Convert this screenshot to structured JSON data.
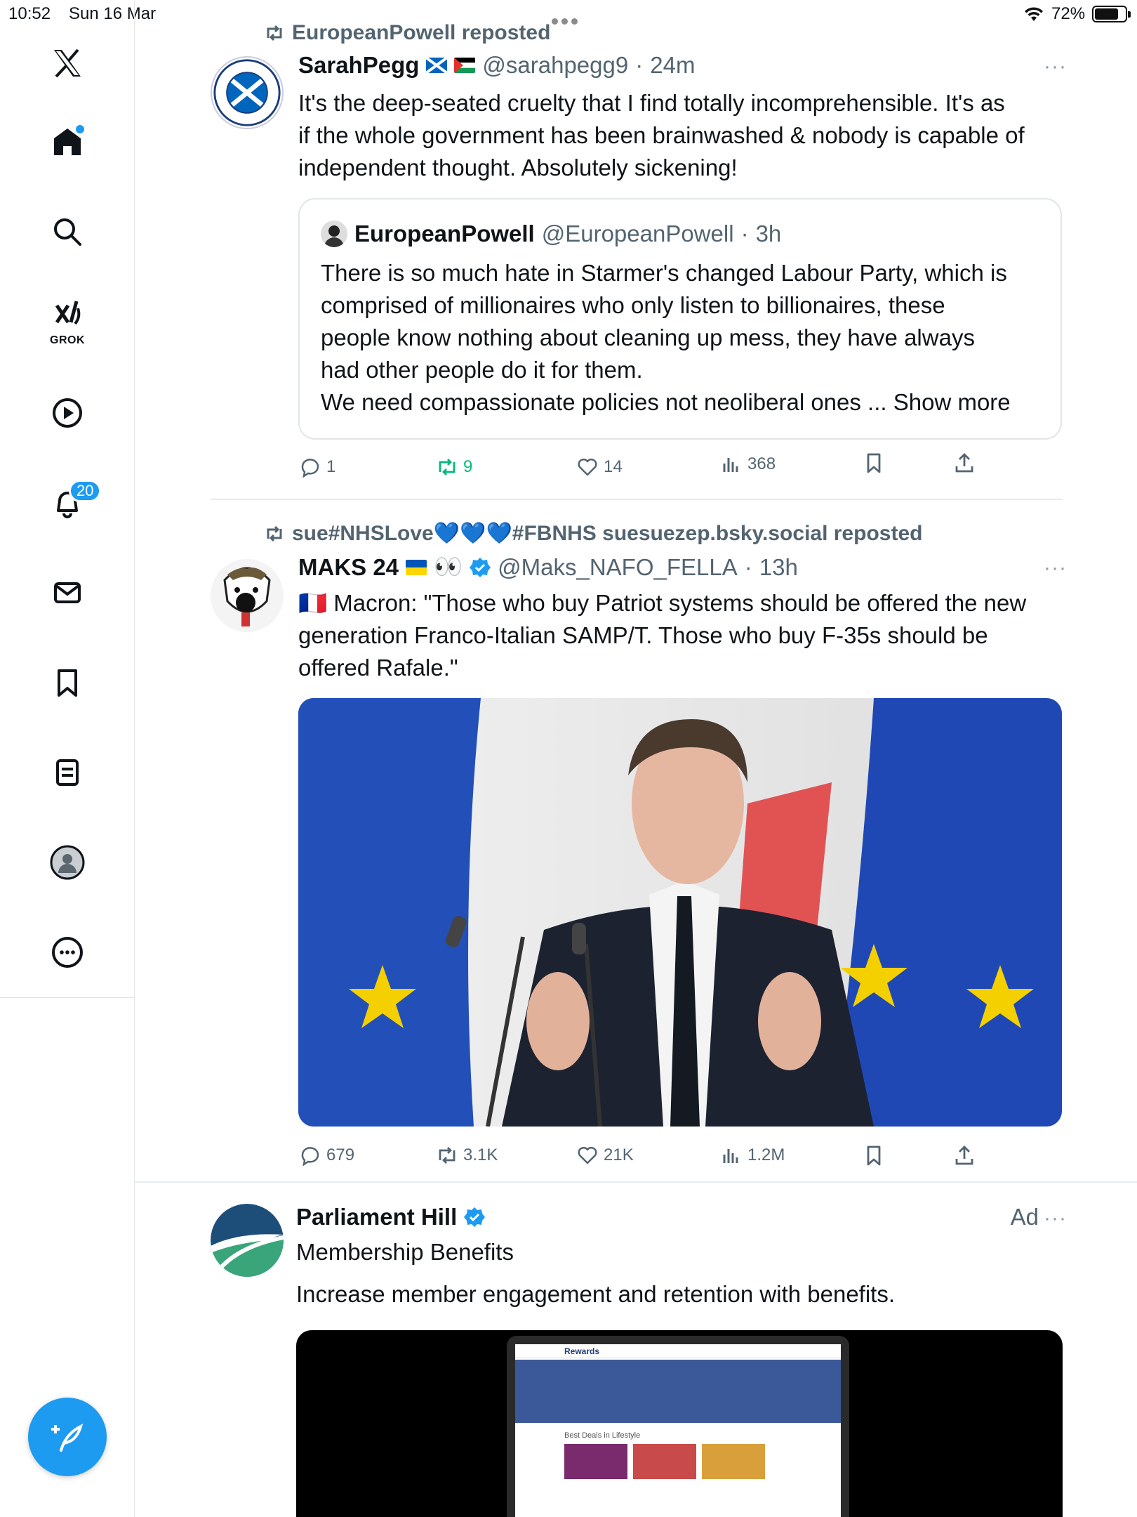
{
  "status_bar": {
    "time": "10:52",
    "date": "Sun 16 Mar",
    "battery": "72%"
  },
  "sidebar": {
    "items": [
      {
        "name": "x-logo"
      },
      {
        "name": "home",
        "has_dot": true
      },
      {
        "name": "search"
      },
      {
        "name": "grok",
        "label": "GROK"
      },
      {
        "name": "video"
      },
      {
        "name": "notifications",
        "badge": "20"
      },
      {
        "name": "messages"
      },
      {
        "name": "bookmarks"
      },
      {
        "name": "lists"
      },
      {
        "name": "profile"
      },
      {
        "name": "more"
      }
    ],
    "compose_label": "Post"
  },
  "posts": [
    {
      "repost_by": "EuropeanPowell reposted",
      "author": "SarahPegg",
      "flags": [
        "scotland",
        "palestine"
      ],
      "handle": "@sarahpegg9",
      "time": "24m",
      "avatar_text": "SCOTTISH CIVIL RIGHTS MOVEMENT",
      "text_lines": [
        "It's the deep-seated cruelty that I find totally incomprehensible.  It's as",
        "if the whole government has been brainwashed & nobody is capable of",
        "independent thought.  Absolutely sickening!"
      ],
      "quote": {
        "author": "EuropeanPowell",
        "handle": "@EuropeanPowell",
        "time": "3h",
        "text_lines": [
          "There is so much hate in Starmer's changed Labour Party, which is",
          "comprised of millionaires who only listen to billionaires, these",
          "people know nothing about cleaning up mess, they have always",
          "had other people do it for them.",
          "We need compassionate policies not neoliberal ones ..."
        ],
        "show_more": "Show more"
      },
      "actions": {
        "replies": "1",
        "reposts": "9",
        "likes": "14",
        "views": "368"
      }
    },
    {
      "repost_by": "sue#NHSLove💙💙💙#FBNHS suesuezep.bsky.social reposted",
      "author": "MAKS 24",
      "emoji": "👀",
      "handle": "@Maks_NAFO_FELLA",
      "time": "13h",
      "text_lines": [
        "🇫🇷 Macron: \"Those who buy Patriot systems should be offered the new",
        "generation Franco-Italian SAMP/T. Those who buy F-35s should be",
        "offered Rafale.\""
      ],
      "actions": {
        "replies": "679",
        "reposts": "3.1K",
        "likes": "21K",
        "views": "1.2M"
      }
    },
    {
      "author": "Parliament Hill",
      "ad_label": "Ad",
      "subtitle": "Membership Benefits",
      "text": "Increase member engagement and retention with benefits.",
      "media": {
        "brand": "Rewards",
        "section": "Best Deals in Lifestyle"
      }
    }
  ],
  "colors": {
    "accent": "#1d9bf0",
    "repost_green": "#00ba7c",
    "secondary_text": "#536471"
  }
}
